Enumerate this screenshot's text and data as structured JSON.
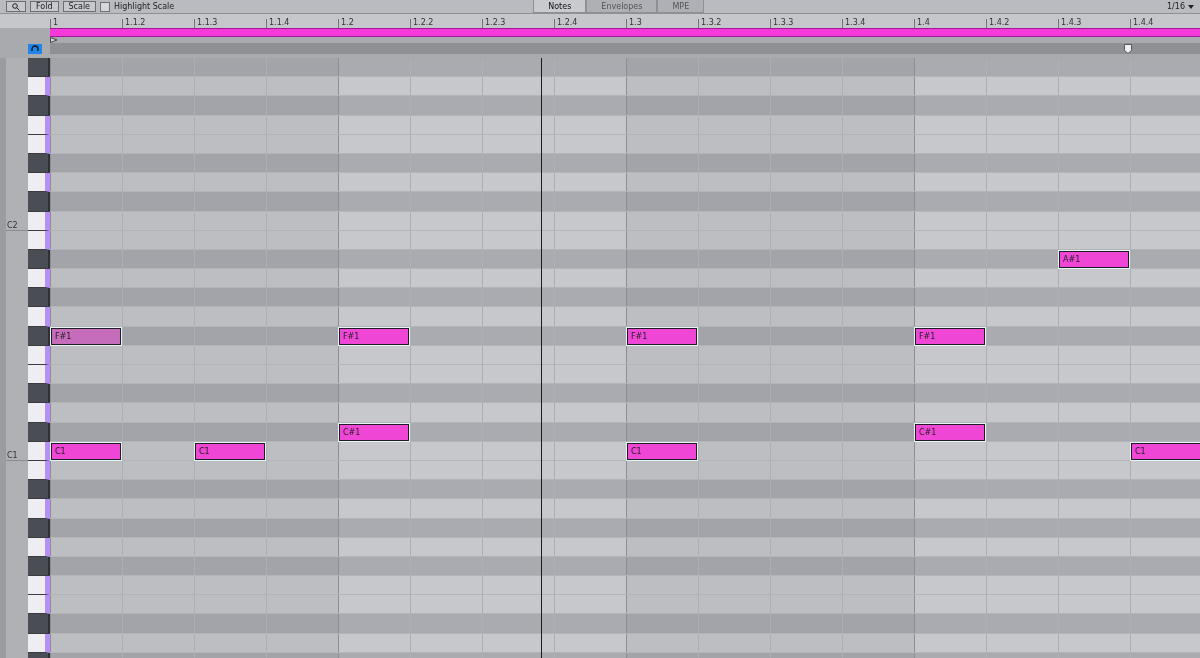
{
  "toolbar": {
    "buttons": [
      "Fold",
      "Scale"
    ],
    "highlight_scale": {
      "label": "Highlight Scale",
      "checked": false
    },
    "tabs": [
      {
        "label": "Notes",
        "selected": true
      },
      {
        "label": "Envelopes",
        "selected": false
      },
      {
        "label": "MPE",
        "selected": false
      }
    ],
    "grid_setting": "1/16"
  },
  "ruler": [
    "1",
    "1.1.2",
    "1.1.3",
    "1.1.4",
    "1.2",
    "1.2.2",
    "1.2.3",
    "1.2.4",
    "1.3",
    "1.3.2",
    "1.3.3",
    "1.3.4",
    "1.4",
    "1.4.2",
    "1.4.3",
    "1.4.4"
  ],
  "preview_on": true,
  "rows": [
    {
      "kind": "sharp"
    },
    {
      "kind": "natural"
    },
    {
      "kind": "sharp"
    },
    {
      "kind": "natural"
    },
    {
      "kind": "natural"
    },
    {
      "kind": "sharp"
    },
    {
      "kind": "natural"
    },
    {
      "kind": "sharp"
    },
    {
      "kind": "natural",
      "label": "C2"
    },
    {
      "kind": "natural"
    },
    {
      "kind": "sharp",
      "steps": [
        {
          "kind": "rest"
        },
        {
          "kind": "rest"
        },
        {
          "kind": "rest"
        },
        {
          "kind": "rest"
        },
        {
          "kind": "rest"
        },
        {
          "kind": "rest"
        },
        {
          "kind": "rest"
        },
        {
          "kind": "rest"
        },
        {
          "kind": "rest"
        },
        {
          "kind": "rest"
        },
        {
          "kind": "rest"
        },
        {
          "kind": "rest"
        },
        {
          "kind": "rest"
        },
        {
          "kind": "rest"
        },
        {
          "kind": "note",
          "label": "A#1",
          "faded": false
        }
      ]
    },
    {
      "kind": "natural"
    },
    {
      "kind": "sharp"
    },
    {
      "kind": "natural"
    },
    {
      "kind": "sharp",
      "steps": [
        {
          "kind": "note",
          "label": "F#1",
          "faded": true
        },
        {
          "kind": "rest"
        },
        {
          "kind": "rest"
        },
        {
          "kind": "rest"
        },
        {
          "kind": "note",
          "label": "F#1",
          "faded": false
        },
        {
          "kind": "rest"
        },
        {
          "kind": "rest"
        },
        {
          "kind": "rest"
        },
        {
          "kind": "note",
          "label": "F#1",
          "faded": false
        },
        {
          "kind": "rest"
        },
        {
          "kind": "rest"
        },
        {
          "kind": "rest"
        },
        {
          "kind": "note",
          "label": "F#1",
          "faded": false
        }
      ]
    },
    {
      "kind": "natural"
    },
    {
      "kind": "natural"
    },
    {
      "kind": "sharp"
    },
    {
      "kind": "natural"
    },
    {
      "kind": "sharp",
      "steps": [
        {
          "kind": "rest"
        },
        {
          "kind": "rest"
        },
        {
          "kind": "rest"
        },
        {
          "kind": "rest"
        },
        {
          "kind": "note",
          "label": "C#1",
          "faded": false
        },
        {
          "kind": "rest"
        },
        {
          "kind": "rest"
        },
        {
          "kind": "rest"
        },
        {
          "kind": "rest"
        },
        {
          "kind": "rest"
        },
        {
          "kind": "rest"
        },
        {
          "kind": "rest"
        },
        {
          "kind": "note",
          "label": "C#1",
          "faded": false
        }
      ]
    },
    {
      "kind": "natural",
      "label": "C1",
      "steps": [
        {
          "kind": "note",
          "label": "C1",
          "faded": false
        },
        {
          "kind": "rest"
        },
        {
          "kind": "note",
          "label": "C1",
          "faded": false
        },
        {
          "kind": "rest"
        },
        {
          "kind": "rest"
        },
        {
          "kind": "rest"
        },
        {
          "kind": "rest"
        },
        {
          "kind": "rest"
        },
        {
          "kind": "note",
          "label": "C1",
          "faded": false
        },
        {
          "kind": "rest"
        },
        {
          "kind": "rest"
        },
        {
          "kind": "rest"
        },
        {
          "kind": "rest"
        },
        {
          "kind": "rest"
        },
        {
          "kind": "rest"
        },
        {
          "kind": "note",
          "label": "C1",
          "faded": false
        }
      ]
    },
    {
      "kind": "natural"
    },
    {
      "kind": "sharp"
    },
    {
      "kind": "natural"
    },
    {
      "kind": "sharp"
    },
    {
      "kind": "natural"
    },
    {
      "kind": "sharp"
    },
    {
      "kind": "natural"
    },
    {
      "kind": "natural"
    },
    {
      "kind": "sharp"
    },
    {
      "kind": "natural"
    },
    {
      "kind": "sharp"
    }
  ]
}
